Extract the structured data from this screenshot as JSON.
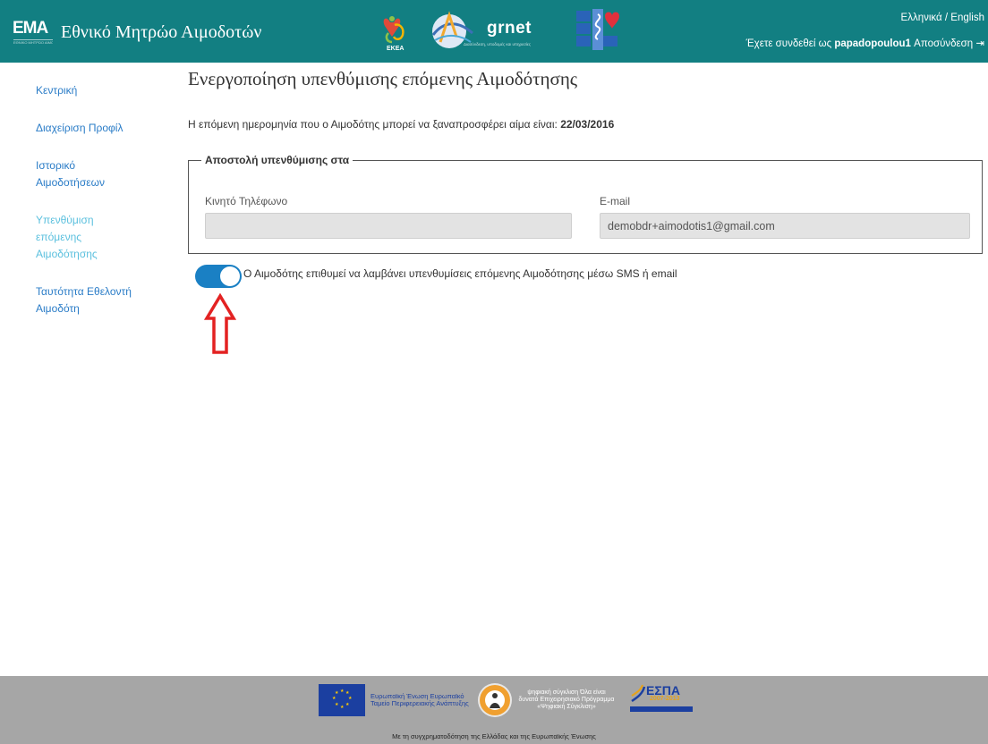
{
  "header": {
    "logo_text": "ΕΜΑ",
    "logo_subtext": "ΕΘΝΙΚΟ ΜΗΤΡΩΟ ΑΙΜΟΔΟΤΩΝ",
    "title": "Εθνικό Μητρώο Αιμοδοτών",
    "partner_keaa_text": "ΕΚΕΑ",
    "partner_grnet_text": "grnet",
    "partner_grnet_tagline": "Διασύνδεση, υποδομές και υπηρεσίες",
    "lang_greek": "Ελληνικά",
    "lang_sep": " / ",
    "lang_english": "English",
    "logged_in_prefix": "Έχετε συνδεθεί ως ",
    "username": "papadopoulou1",
    "logout_label": "Αποσύνδεση",
    "accent_color": "#127f82"
  },
  "sidebar": {
    "items": [
      {
        "label": "Κεντρική",
        "active": false
      },
      {
        "label": "Διαχείριση Προφίλ",
        "active": false
      },
      {
        "label": "Ιστορικό Αιμοδοτήσεων",
        "active": false
      },
      {
        "label": "Υπενθύμιση επόμενης Αιμοδότησης",
        "active": true
      },
      {
        "label": "Ταυτότητα Εθελοντή Αιμοδότη",
        "active": false
      }
    ],
    "link_color": "#2a7cc7",
    "active_color": "#5bc0de"
  },
  "main": {
    "title": "Ενεργοποίηση υπενθύμισης επόμενης Αιμοδότησης",
    "next_date_text": "Η επόμενη ημερομηνία που ο Αιμοδότης μπορεί να ξαναπροσφέρει αίμα είναι: ",
    "next_date_value": "22/03/2016",
    "fieldset_legend": "Αποστολή υπενθύμισης στα",
    "phone_label": "Κινητό Τηλέφωνο",
    "phone_value": "",
    "email_label": "E-mail",
    "email_value": "demobdr+aimodotis1@gmail.com",
    "toggle_on": true,
    "toggle_color": "#1a80c4",
    "toggle_text": "Ο Αιμοδότης επιθυμεί να λαμβάνει υπενθυμίσεις επόμενης Αιμοδότησης μέσω SMS ή email",
    "arrow_color": "#e32222"
  },
  "footer": {
    "eu_text": "Ευρωπαϊκή Ένωση Ευρωπαϊκό Ταμείο Περιφερειακής Ανάπτυξης",
    "digital_text": "ψηφιακή σύγκλιση Όλα είναι δυνατά Επιχειρησιακό Πρόγραμμα «Ψηφιακή Σύγκλιση»",
    "espa_text": "ΕΣΠΑ",
    "espa_years": "2007-2013",
    "caption": "Με τη συγχρηματοδότηση της Ελλάδας και της Ευρωπαϊκής Ένωσης",
    "background": "#a6a6a6"
  }
}
